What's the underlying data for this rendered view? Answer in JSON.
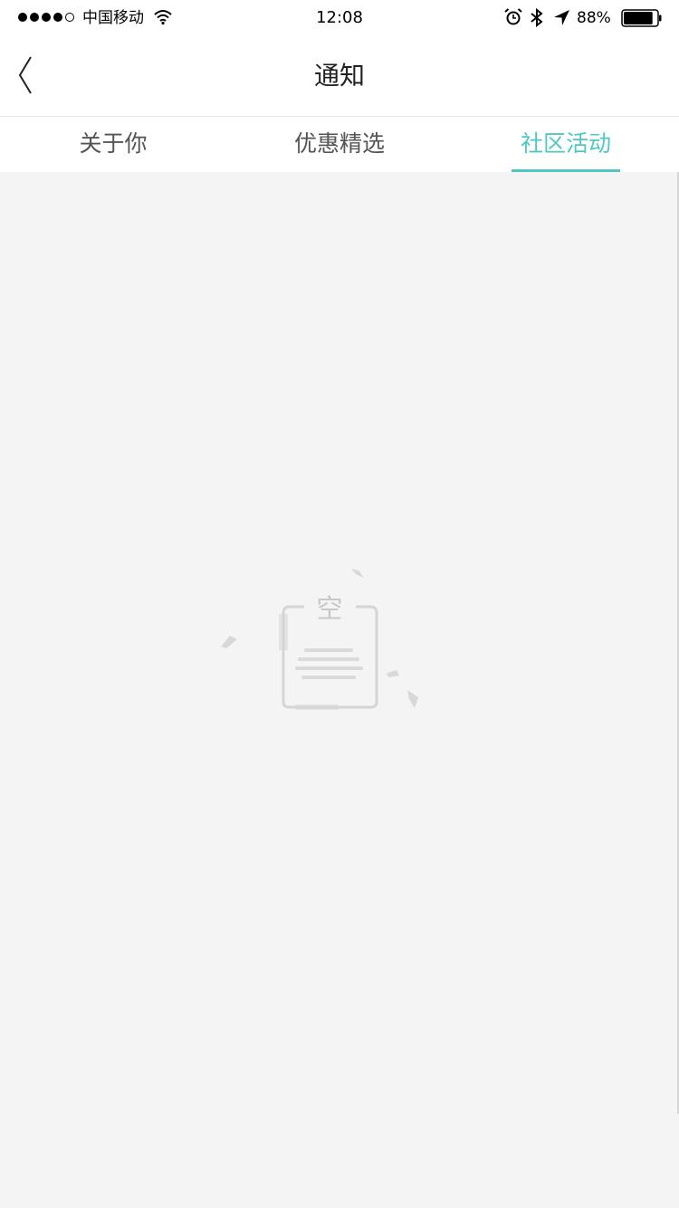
{
  "status_bar": {
    "carrier": "中国移动",
    "time": "12:08",
    "battery_percent": "88%",
    "battery_level": 0.88,
    "signal_bars_filled": 4,
    "signal_bars_total": 5,
    "icons": [
      "wifi-icon",
      "alarm-icon",
      "bluetooth-icon",
      "location-icon",
      "battery-icon"
    ]
  },
  "nav": {
    "title": "通知",
    "back_icon": "chevron-left-icon"
  },
  "tabs": [
    {
      "label": "关于你",
      "active": false
    },
    {
      "label": "优惠精选",
      "active": false
    },
    {
      "label": "社区活动",
      "active": true
    }
  ],
  "empty_state": {
    "icon": "empty-document-icon",
    "char": "空"
  },
  "colors": {
    "accent": "#4fc7c3",
    "background": "#f4f4f4",
    "tab_text": "#555555",
    "illustration": "#d5d5d5"
  }
}
